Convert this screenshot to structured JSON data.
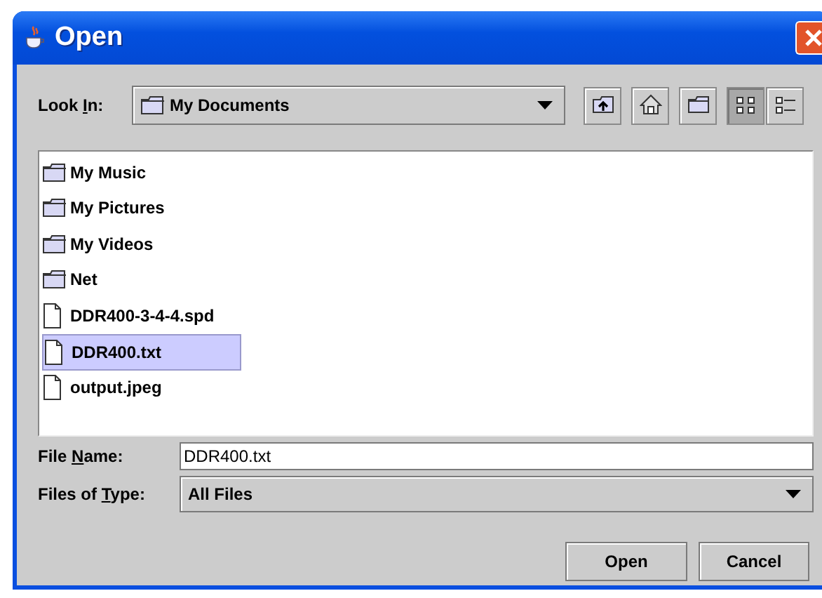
{
  "window": {
    "title": "Open"
  },
  "look_in": {
    "label": {
      "before": "Look ",
      "mnemonic": "I",
      "after": "n:"
    },
    "value": "My Documents"
  },
  "toolbar": [
    {
      "kind": "up-folder",
      "selected": false
    },
    {
      "kind": "home",
      "selected": false
    },
    {
      "kind": "new-folder",
      "selected": false
    },
    {
      "kind": "list-view",
      "selected": true
    },
    {
      "kind": "details-view",
      "selected": false
    }
  ],
  "files": [
    {
      "name": "My Music",
      "kind": "folder",
      "selected": false
    },
    {
      "name": "My Pictures",
      "kind": "folder",
      "selected": false
    },
    {
      "name": "My Videos",
      "kind": "folder",
      "selected": false
    },
    {
      "name": "Net",
      "kind": "folder",
      "selected": false
    },
    {
      "name": "DDR400-3-4-4.spd",
      "kind": "file",
      "selected": false
    },
    {
      "name": "DDR400.txt",
      "kind": "file",
      "selected": true
    },
    {
      "name": "output.jpeg",
      "kind": "file",
      "selected": false
    }
  ],
  "file_name": {
    "label": {
      "before": "File ",
      "mnemonic": "N",
      "after": "ame:"
    },
    "value": "DDR400.txt"
  },
  "file_type": {
    "label": {
      "before": "Files of ",
      "mnemonic": "T",
      "after": "ype:"
    },
    "value": "All Files"
  },
  "buttons": [
    "Open",
    "Cancel"
  ]
}
